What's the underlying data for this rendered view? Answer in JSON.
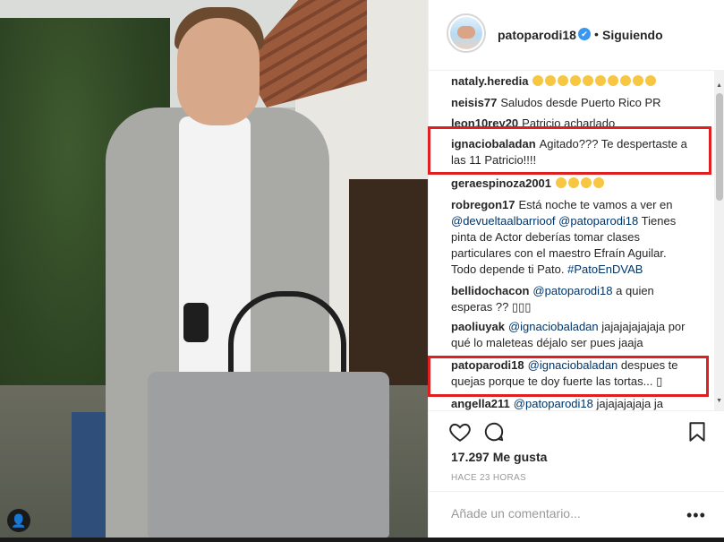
{
  "post": {
    "author": "patoparodi18",
    "verified_glyph": "✔",
    "separator": "•",
    "follow_status": "Siguiendo",
    "likes": "17.297 Me gusta",
    "timestamp": "HACE 23 HORAS",
    "add_comment_placeholder": "Añade un comentario...",
    "more_icon": "•••",
    "user_tag_icon": "👤"
  },
  "comments": [
    {
      "user": "nataly.heredia",
      "text": "",
      "emoji_count": 10
    },
    {
      "user": "neisis77",
      "text": "Saludos desde Puerto Rico PR"
    },
    {
      "user": "leon10rey20",
      "text": "Patricio acharlado"
    },
    {
      "user": "ignaciobaladan",
      "text": "Agitado??? Te despertaste a las 11 Patricio!!!!"
    },
    {
      "user": "geraespinoza2001",
      "text": "",
      "emoji_count": 4
    },
    {
      "user": "robregon17",
      "text": "Está noche te vamos a ver en",
      "mention1": "@devueltaalbarrioof",
      "mention2": "@patoparodi18",
      "text2": "Tienes pinta de Actor deberías tomar clases particulares con el maestro Efraín Aguilar. Todo depende ti Pato.",
      "hashtag": "#PatoEnDVAB"
    },
    {
      "user": "bellidochacon",
      "mention": "@patoparodi18",
      "text": "a quien esperas ?? ▯▯▯"
    },
    {
      "user": "paoliuyak",
      "mention": "@ignaciobaladan",
      "text": "jajajajajajaja por qué lo maleteas déjalo ser pues jaaja"
    },
    {
      "user": "patoparodi18",
      "mention": "@ignaciobaladan",
      "text": "despues te quejas porque te doy fuerte las tortas... ▯"
    },
    {
      "user": "angella211",
      "mention": "@patoparodi18",
      "text": "jajajajajaja ja"
    }
  ],
  "colors": {
    "highlight": "#e02020",
    "mention": "#003569",
    "verified": "#3897f0"
  }
}
